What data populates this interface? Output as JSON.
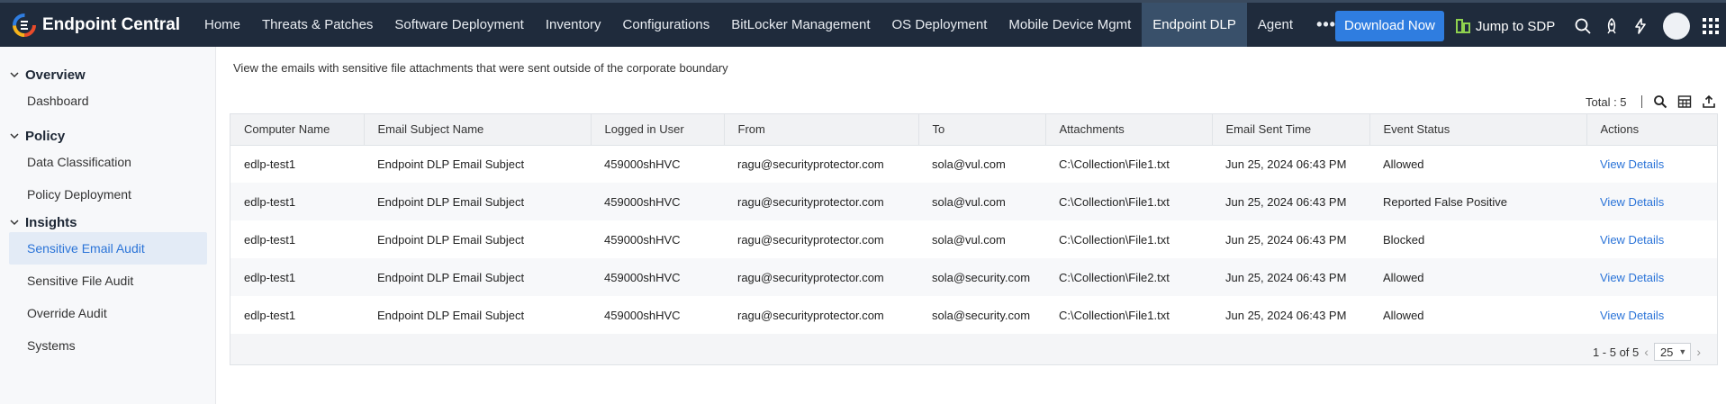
{
  "app": {
    "name": "Endpoint Central"
  },
  "nav": {
    "tabs": [
      {
        "label": "Home"
      },
      {
        "label": "Threats & Patches"
      },
      {
        "label": "Software Deployment"
      },
      {
        "label": "Inventory"
      },
      {
        "label": "Configurations"
      },
      {
        "label": "BitLocker Management"
      },
      {
        "label": "OS Deployment"
      },
      {
        "label": "Mobile Device Mgmt"
      },
      {
        "label": "Endpoint DLP"
      },
      {
        "label": "Agent"
      }
    ],
    "more": "•••",
    "active_tab": "Endpoint DLP",
    "download_label": "Download Now",
    "jump_label": "Jump to SDP"
  },
  "sidebar": {
    "sections": [
      {
        "title": "Overview",
        "items": [
          "Dashboard"
        ]
      },
      {
        "title": "Policy",
        "items": [
          "Data Classification",
          "Policy Deployment"
        ]
      },
      {
        "title": "Insights",
        "items": [
          "Sensitive Email Audit",
          "Sensitive File Audit",
          "Override Audit",
          "Systems"
        ]
      }
    ],
    "active_item": "Sensitive Email Audit"
  },
  "main": {
    "description": "View the emails with sensitive file attachments that were sent outside of the corporate boundary",
    "total_label": "Total : 5",
    "columns": [
      "Computer Name",
      "Email Subject Name",
      "Logged in User",
      "From",
      "To",
      "Attachments",
      "Email Sent Time",
      "Event Status",
      "Actions"
    ],
    "rows": [
      [
        "edlp-test1",
        "Endpoint DLP Email Subject",
        "459000shHVC",
        "ragu@securityprotector.com",
        "sola@vul.com",
        "C:\\Collection\\File1.txt",
        "Jun 25, 2024 06:43 PM",
        "Allowed",
        "View Details"
      ],
      [
        "edlp-test1",
        "Endpoint DLP Email Subject",
        "459000shHVC",
        "ragu@securityprotector.com",
        "sola@vul.com",
        "C:\\Collection\\File1.txt",
        "Jun 25, 2024 06:43 PM",
        "Reported False Positive",
        "View Details"
      ],
      [
        "edlp-test1",
        "Endpoint DLP Email Subject",
        "459000shHVC",
        "ragu@securityprotector.com",
        "sola@vul.com",
        "C:\\Collection\\File1.txt",
        "Jun 25, 2024 06:43 PM",
        "Blocked",
        "View Details"
      ],
      [
        "edlp-test1",
        "Endpoint DLP Email Subject",
        "459000shHVC",
        "ragu@securityprotector.com",
        "sola@security.com",
        "C:\\Collection\\File2.txt",
        "Jun 25, 2024 06:43 PM",
        "Allowed",
        "View Details"
      ],
      [
        "edlp-test1",
        "Endpoint DLP Email Subject",
        "459000shHVC",
        "ragu@securityprotector.com",
        "sola@security.com",
        "C:\\Collection\\File1.txt",
        "Jun 25, 2024 06:43 PM",
        "Allowed",
        "View Details"
      ]
    ],
    "pagination": {
      "range": "1 - 5 of 5",
      "page_size": "25"
    }
  },
  "icons": [
    "logo-icon",
    "search-icon",
    "rocket-icon",
    "bolt-icon",
    "avatar",
    "apps-grid-icon",
    "sdp-icon",
    "table-search-icon",
    "column-chooser-icon",
    "export-icon",
    "chevron-down-icon"
  ],
  "colors": {
    "topbar": "#1f2b3c",
    "active_tab": "#39506a",
    "accent": "#2f7de0",
    "link": "#2b74d8",
    "sidebar_active": "#e3ebf6"
  }
}
